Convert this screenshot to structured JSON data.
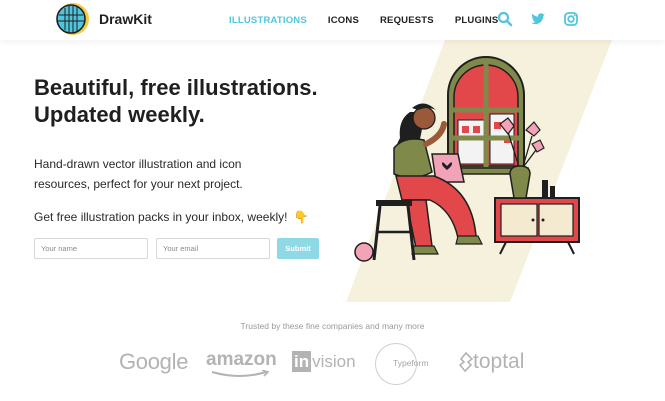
{
  "header": {
    "brand": "DrawKit",
    "nav": [
      {
        "label": "ILLUSTRATIONS",
        "active": true
      },
      {
        "label": "ICONS",
        "active": false
      },
      {
        "label": "REQUESTS",
        "active": false
      },
      {
        "label": "PLUGINS",
        "active": false
      }
    ],
    "icons": [
      "search-icon",
      "twitter-icon",
      "instagram-icon"
    ],
    "accent_color": "#4fc6dd"
  },
  "hero": {
    "title_line1": "Beautiful, free illustrations.",
    "title_line2": "Updated weekly.",
    "subtitle": "Hand-drawn vector illustration and icon resources, perfect for your next project.",
    "cta": "Get free illustration packs in your inbox, weekly!",
    "cta_emoji": "👇",
    "name_placeholder": "Your name",
    "email_placeholder": "Your email",
    "submit_label": "Submit"
  },
  "trusted": {
    "heading": "Trusted by these fine companies and many more",
    "logos": {
      "google": "Google",
      "amazon": "amazon",
      "invision_in": "in",
      "invision_rest": "vision",
      "typeform": "Typeform",
      "toptal": "toptal"
    }
  },
  "colors": {
    "submit_bg": "#8fd8e6",
    "illustration_bg": "#f6f1dc",
    "red": "#e2474a",
    "green": "#7f8a4a",
    "pink": "#f2a3b7"
  }
}
